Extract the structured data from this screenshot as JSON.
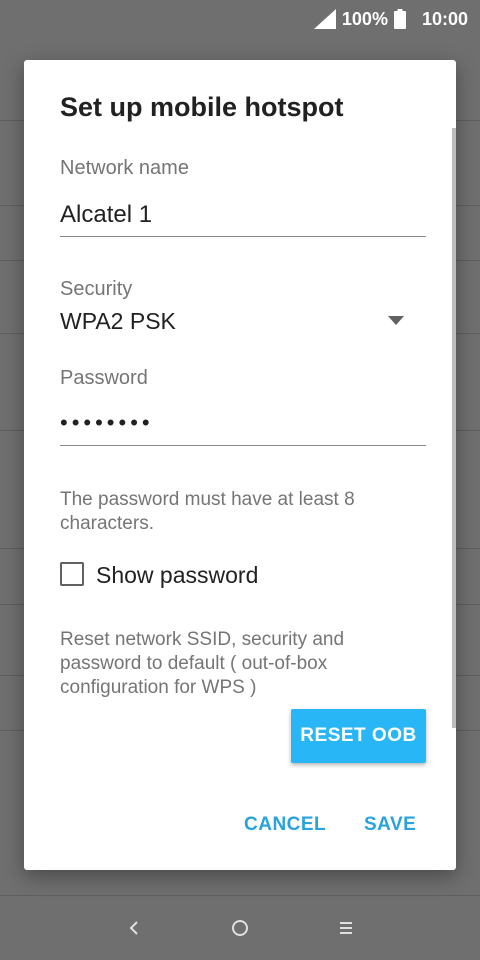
{
  "status_bar": {
    "battery": "100%",
    "time": "10:00",
    "icons": [
      "signal-icon",
      "battery-icon"
    ]
  },
  "dialog": {
    "title": "Set up mobile hotspot",
    "network_name": {
      "label": "Network name",
      "value": "Alcatel 1"
    },
    "security": {
      "label": "Security",
      "selected": "WPA2 PSK"
    },
    "password": {
      "label": "Password",
      "masked_value": "••••••••",
      "hint": "The password must have at least 8 characters."
    },
    "show_password": {
      "label": "Show password",
      "checked": false
    },
    "reset_note": "Reset network SSID, security and password to default ( out-of-box configuration for WPS )",
    "reset_button": "RESET OOB",
    "cancel_button": "CANCEL",
    "save_button": "SAVE"
  },
  "colors": {
    "accent": "#29b6f6",
    "accent_text": "#29a3dd",
    "scrim": "#6f6f6f"
  },
  "nav_bar": {
    "icons": [
      "back-icon",
      "home-icon",
      "recents-icon"
    ]
  }
}
